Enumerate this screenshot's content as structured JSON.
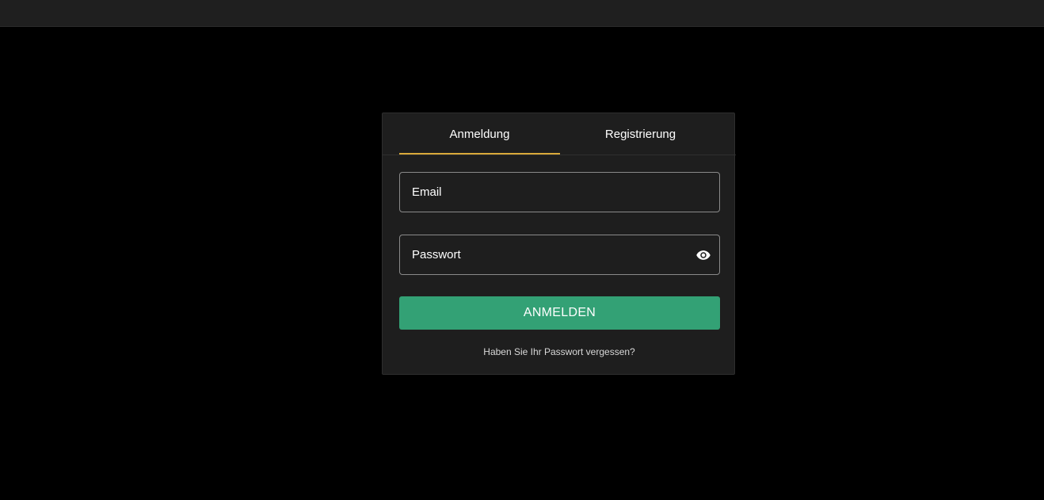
{
  "tabs": {
    "login_label": "Anmeldung",
    "register_label": "Registrierung",
    "active": "login"
  },
  "form": {
    "email_placeholder": "Email",
    "email_value": "",
    "password_placeholder": "Passwort",
    "password_value": "",
    "password_toggle_icon": "eye-icon",
    "submit_label": "ANMELDEN",
    "forgot_label": "Haben Sie Ihr Passwort vergessen?"
  },
  "colors": {
    "page_background": "#000000",
    "topbar": "#1f1f1f",
    "card": "#1e1e1e",
    "active_tab_underline": "#d9a93a",
    "primary_button": "#33a175"
  }
}
